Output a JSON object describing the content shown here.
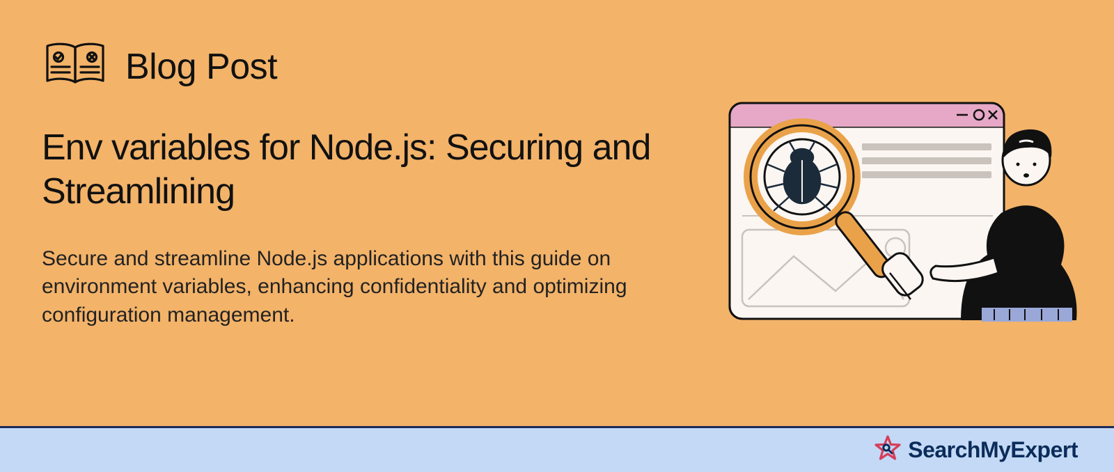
{
  "header": {
    "category_label": "Blog Post"
  },
  "post": {
    "title": "Env variables for Node.js: Securing and Streamlining",
    "description": "Secure and streamline Node.js applications with this guide on environment variables, enhancing confidentiality and optimizing configuration management."
  },
  "brand": {
    "name": "SearchMyExpert"
  },
  "colors": {
    "background": "#f3b369",
    "footer_bg": "#c3d9f5",
    "footer_border": "#1b2b5a",
    "text": "#111",
    "brand_text": "#0b2c5a",
    "accent_star": "#d63d5a",
    "accent_orange": "#eaa24a",
    "accent_pink": "#e6a8c6"
  }
}
